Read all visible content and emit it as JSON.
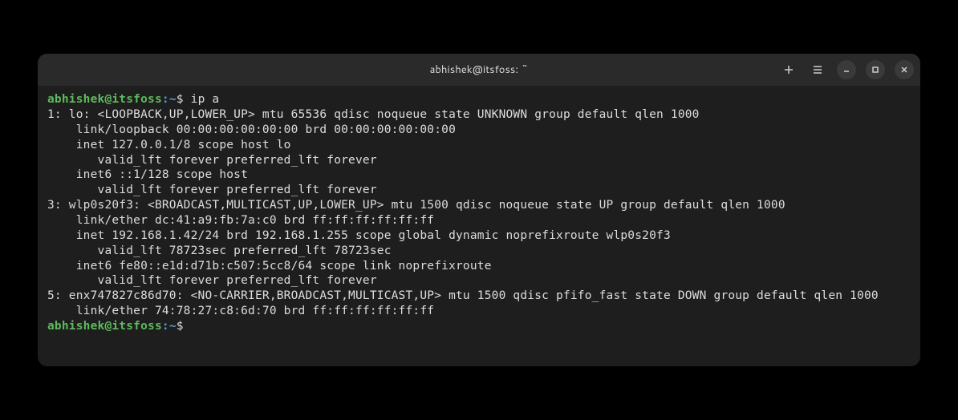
{
  "window": {
    "title": "abhishek@itsfoss: ~"
  },
  "prompt": {
    "user_host": "abhishek@itsfoss",
    "colon": ":",
    "path": "~",
    "dollar": "$"
  },
  "command": "ip a",
  "output": [
    "1: lo: <LOOPBACK,UP,LOWER_UP> mtu 65536 qdisc noqueue state UNKNOWN group default qlen 1000",
    "    link/loopback 00:00:00:00:00:00 brd 00:00:00:00:00:00",
    "    inet 127.0.0.1/8 scope host lo",
    "       valid_lft forever preferred_lft forever",
    "    inet6 ::1/128 scope host ",
    "       valid_lft forever preferred_lft forever",
    "3: wlp0s20f3: <BROADCAST,MULTICAST,UP,LOWER_UP> mtu 1500 qdisc noqueue state UP group default qlen 1000",
    "    link/ether dc:41:a9:fb:7a:c0 brd ff:ff:ff:ff:ff:ff",
    "    inet 192.168.1.42/24 brd 192.168.1.255 scope global dynamic noprefixroute wlp0s20f3",
    "       valid_lft 78723sec preferred_lft 78723sec",
    "    inet6 fe80::e1d:d71b:c507:5cc8/64 scope link noprefixroute ",
    "       valid_lft forever preferred_lft forever",
    "5: enx747827c86d70: <NO-CARRIER,BROADCAST,MULTICAST,UP> mtu 1500 qdisc pfifo_fast state DOWN group default qlen 1000",
    "    link/ether 74:78:27:c8:6d:70 brd ff:ff:ff:ff:ff:ff"
  ]
}
